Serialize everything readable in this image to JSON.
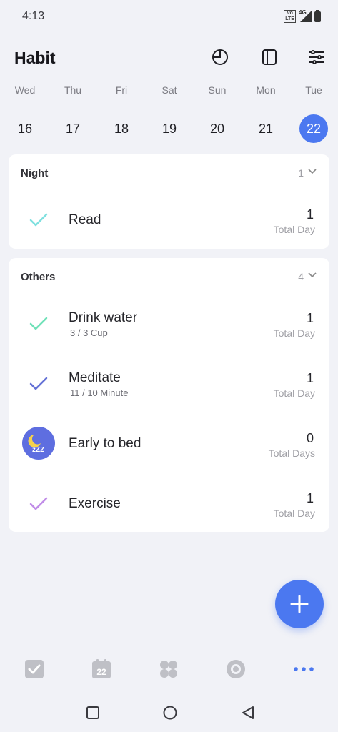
{
  "status_bar": {
    "time": "4:13",
    "volte_line1": "Vo",
    "volte_line2": "LTE",
    "network": "4G"
  },
  "header": {
    "title": "Habit",
    "stats_icon": "pie-chart-icon",
    "widget_icon": "tablet-icon",
    "settings_icon": "sliders-icon"
  },
  "week": {
    "days": [
      {
        "name": "Wed",
        "num": "16"
      },
      {
        "name": "Thu",
        "num": "17"
      },
      {
        "name": "Fri",
        "num": "18"
      },
      {
        "name": "Sat",
        "num": "19"
      },
      {
        "name": "Sun",
        "num": "20"
      },
      {
        "name": "Mon",
        "num": "21"
      },
      {
        "name": "Tue",
        "num": "22"
      }
    ],
    "selected": "22"
  },
  "sections": [
    {
      "title": "Night",
      "count": "1",
      "habits": [
        {
          "name": "Read",
          "sub": "",
          "value": "1",
          "unit": "Total Day",
          "icon": "check-icon",
          "color": "#7fe0df"
        }
      ]
    },
    {
      "title": "Others",
      "count": "4",
      "habits": [
        {
          "name": "Drink water",
          "sub": "3 / 3 Cup",
          "value": "1",
          "unit": "Total Day",
          "icon": "check-icon",
          "color": "#6fe1b8"
        },
        {
          "name": "Meditate",
          "sub": "11 / 10 Minute",
          "value": "1",
          "unit": "Total Day",
          "icon": "check-icon",
          "color": "#6471d6"
        },
        {
          "name": "Early to bed",
          "sub": "",
          "value": "0",
          "unit": "Total Days",
          "icon": "moon-sleep-icon",
          "color": "#5e6ee0"
        },
        {
          "name": "Exercise",
          "sub": "",
          "value": "1",
          "unit": "Total Day",
          "icon": "check-icon",
          "color": "#c18de8"
        }
      ]
    }
  ],
  "sleep_icon_text": "zZZ",
  "fab": {
    "icon": "plus-icon",
    "color": "#4b78f0"
  },
  "bottom_nav": {
    "items": [
      {
        "icon": "task-check-icon",
        "active": false
      },
      {
        "icon": "calendar-icon",
        "label": "22",
        "active": false
      },
      {
        "icon": "grid-apps-icon",
        "active": false
      },
      {
        "icon": "focus-circle-icon",
        "active": false
      },
      {
        "icon": "more-dots-icon",
        "active": true
      }
    ],
    "accent": "#4b78f0"
  },
  "system_nav": {
    "items": [
      "recent-apps-icon",
      "home-icon",
      "back-icon"
    ]
  }
}
